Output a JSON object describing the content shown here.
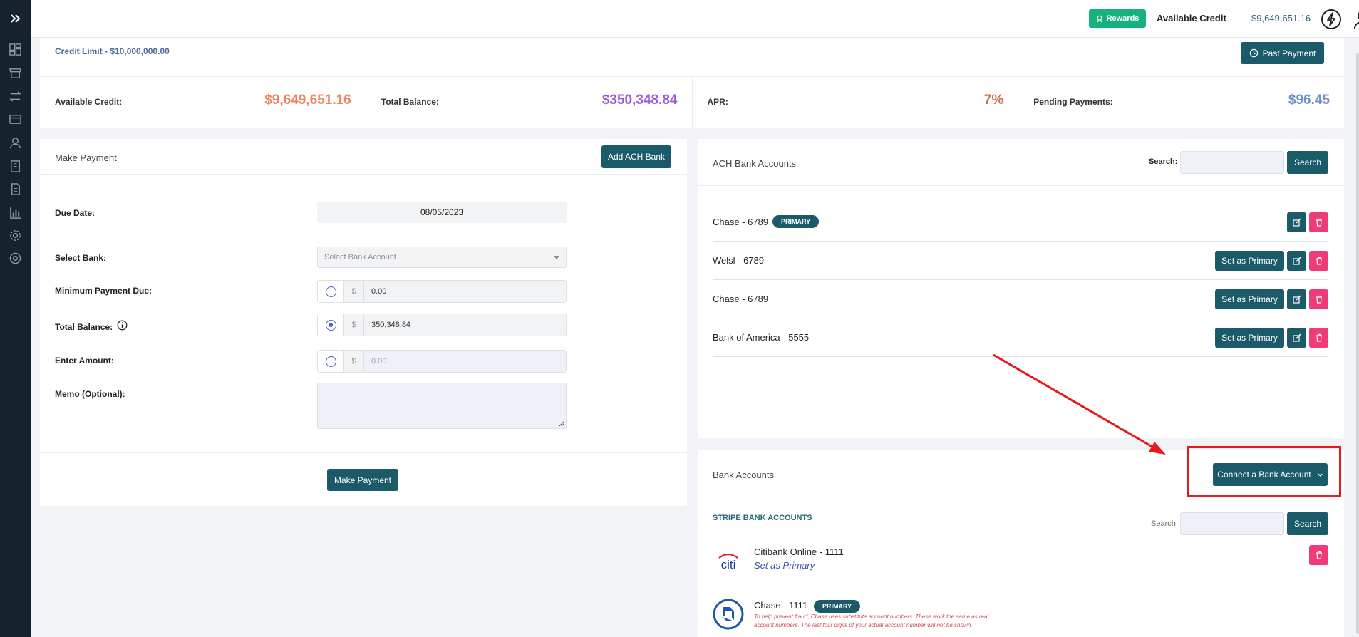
{
  "header": {
    "rewards_label": "Rewards",
    "available_credit_label": "Available Credit",
    "available_credit_value": "$9,649,651.16"
  },
  "summary": {
    "credit_limit": "Credit Limit - $10,000,000.00",
    "past_payment_label": "Past Payment",
    "stats": [
      {
        "label": "Available Credit:",
        "value": "$9,649,651.16",
        "color": "#f0845e"
      },
      {
        "label": "Total Balance:",
        "value": "$350,348.84",
        "color": "#9a5bd6"
      },
      {
        "label": "APR:",
        "value": "7%",
        "color": "#c8714f"
      },
      {
        "label": "Pending Payments:",
        "value": "$96.45",
        "color": "#6f8fc8"
      }
    ]
  },
  "make_payment": {
    "title": "Make Payment",
    "add_ach_label": "Add ACH Bank",
    "due_date_label": "Due Date:",
    "due_date_value": "08/05/2023",
    "select_bank_label": "Select Bank:",
    "select_bank_placeholder": "Select Bank Account",
    "min_payment_label": "Minimum Payment Due:",
    "min_payment_value": "0.00",
    "total_balance_label": "Total Balance:",
    "total_balance_value": "350,348.84",
    "enter_amount_label": "Enter Amount:",
    "enter_amount_placeholder": "0.00",
    "memo_label": "Memo (Optional):",
    "currency": "$",
    "submit_label": "Make Payment"
  },
  "ach": {
    "title": "ACH Bank Accounts",
    "search_label": "Search:",
    "search_button": "Search",
    "primary_badge": "PRIMARY",
    "set_primary_label": "Set as Primary",
    "rows": [
      {
        "name": "Chase - 6789"
      },
      {
        "name": "Welsl - 6789"
      },
      {
        "name": "Chase - 6789"
      },
      {
        "name": "Bank of America - 5555"
      }
    ]
  },
  "bank_accounts": {
    "title": "Bank Accounts",
    "connect_label": "Connect a Bank Account",
    "stripe_title": "STRIPE BANK ACCOUNTS",
    "search_label": "Search:",
    "search_button": "Search",
    "items": [
      {
        "name": "Citibank Online - 1111",
        "link": "Set as Primary",
        "logo": "citi"
      },
      {
        "name": "Chase - 1111",
        "badge": "PRIMARY",
        "note": "To help prevent fraud, Chase uses substitute account numbers. These work the same as real account numbers. The last four digits of your actual account number will not be shown."
      }
    ]
  },
  "colors": {
    "primary": "#1b5a68",
    "danger": "#ef3b7a",
    "rewards": "#17b07f",
    "annotation": "#e8191a"
  }
}
